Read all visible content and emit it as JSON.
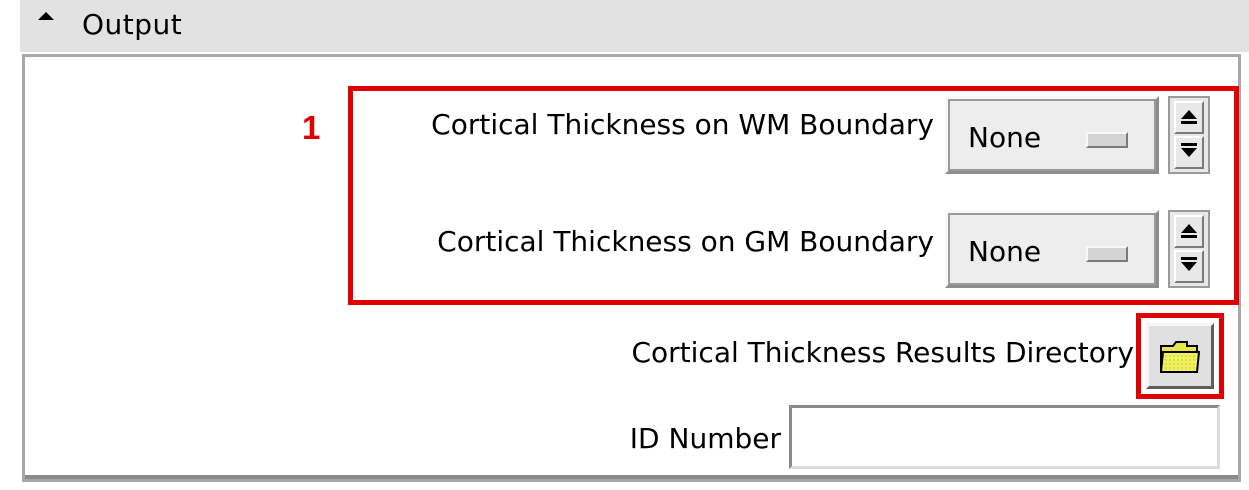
{
  "section": {
    "title": "Output",
    "collapse_icon": "triangle-up-icon"
  },
  "annotations": {
    "group_number": "1",
    "highlight_color": "#e00000"
  },
  "fields": {
    "wm_boundary": {
      "label": "Cortical Thickness on WM Boundary",
      "value": "None"
    },
    "gm_boundary": {
      "label": "Cortical Thickness on GM Boundary",
      "value": "None"
    },
    "results_directory": {
      "label": "Cortical Thickness Results Directory",
      "icon": "folder-icon"
    },
    "id_number": {
      "label": "ID Number",
      "value": ""
    }
  }
}
